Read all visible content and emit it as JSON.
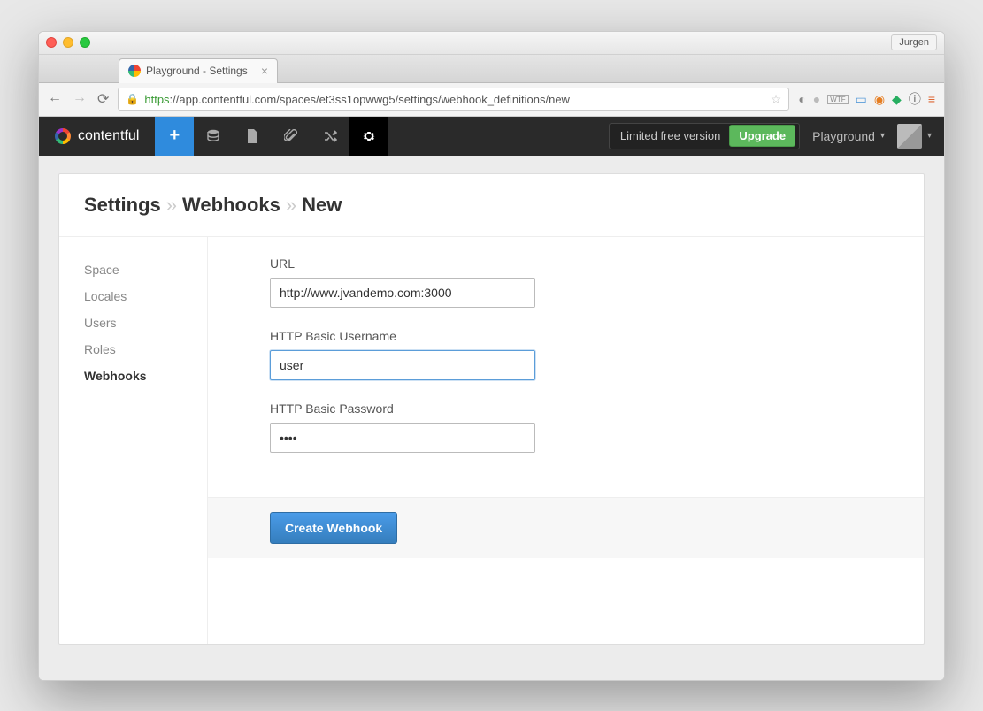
{
  "os": {
    "user_badge": "Jurgen"
  },
  "browser": {
    "tab_title": "Playground - Settings",
    "url_proto": "https",
    "url_rest": "://app.contentful.com/spaces/et3ss1opwwg5/settings/webhook_definitions/new"
  },
  "header": {
    "brand": "contentful",
    "limited_text": "Limited free version",
    "upgrade_label": "Upgrade",
    "space_name": "Playground"
  },
  "breadcrumb": {
    "a": "Settings",
    "b": "Webhooks",
    "c": "New"
  },
  "sidebar": {
    "items": [
      {
        "label": "Space",
        "active": false
      },
      {
        "label": "Locales",
        "active": false
      },
      {
        "label": "Users",
        "active": false
      },
      {
        "label": "Roles",
        "active": false
      },
      {
        "label": "Webhooks",
        "active": true
      }
    ]
  },
  "form": {
    "url_label": "URL",
    "url_value": "http://www.jvandemo.com:3000",
    "user_label": "HTTP Basic Username",
    "user_value": "user",
    "pass_label": "HTTP Basic Password",
    "pass_value": "••••",
    "submit_label": "Create Webhook"
  }
}
